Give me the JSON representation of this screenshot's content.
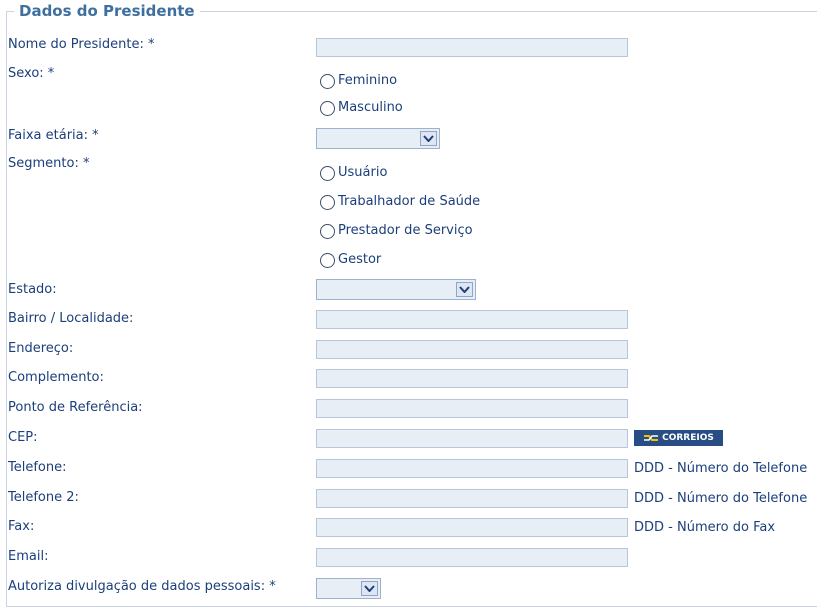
{
  "section": {
    "title": "Dados do Presidente"
  },
  "fields": {
    "nome": {
      "label": "Nome do Presidente: *"
    },
    "sexo": {
      "label": "Sexo: *",
      "options": [
        "Feminino",
        "Masculino"
      ]
    },
    "faixa": {
      "label": "Faixa etária: *",
      "value": ""
    },
    "segmento": {
      "label": "Segmento: *",
      "options": [
        "Usuário",
        "Trabalhador de Saúde",
        "Prestador de Serviço",
        "Gestor"
      ]
    },
    "estado": {
      "label": "Estado:",
      "value": ""
    },
    "bairro": {
      "label": "Bairro / Localidade:"
    },
    "endereco": {
      "label": "Endereço:"
    },
    "complemento": {
      "label": "Complemento:"
    },
    "referencia": {
      "label": "Ponto de Referência:"
    },
    "cep": {
      "label": "CEP:",
      "correios_label": "CORREIOS"
    },
    "telefone": {
      "label": "Telefone:",
      "hint": "DDD - Número do Telefone"
    },
    "telefone2": {
      "label": "Telefone 2:",
      "hint": "DDD - Número do Telefone"
    },
    "fax": {
      "label": "Fax:",
      "hint": "DDD - Número do Fax"
    },
    "email": {
      "label": "Email:"
    },
    "autoriza": {
      "label": "Autoriza divulgação de dados pessoais: *",
      "value": ""
    }
  },
  "icons": {
    "dropdown": "chevron-down-icon",
    "radio": "radio-icon",
    "correios": "correios-logo"
  },
  "colors": {
    "label": "#1b3f7a",
    "legend": "#3f6f9f",
    "input_bg": "#e8eef5",
    "input_border": "#b8c6d8",
    "correios_bg": "#274d84"
  }
}
